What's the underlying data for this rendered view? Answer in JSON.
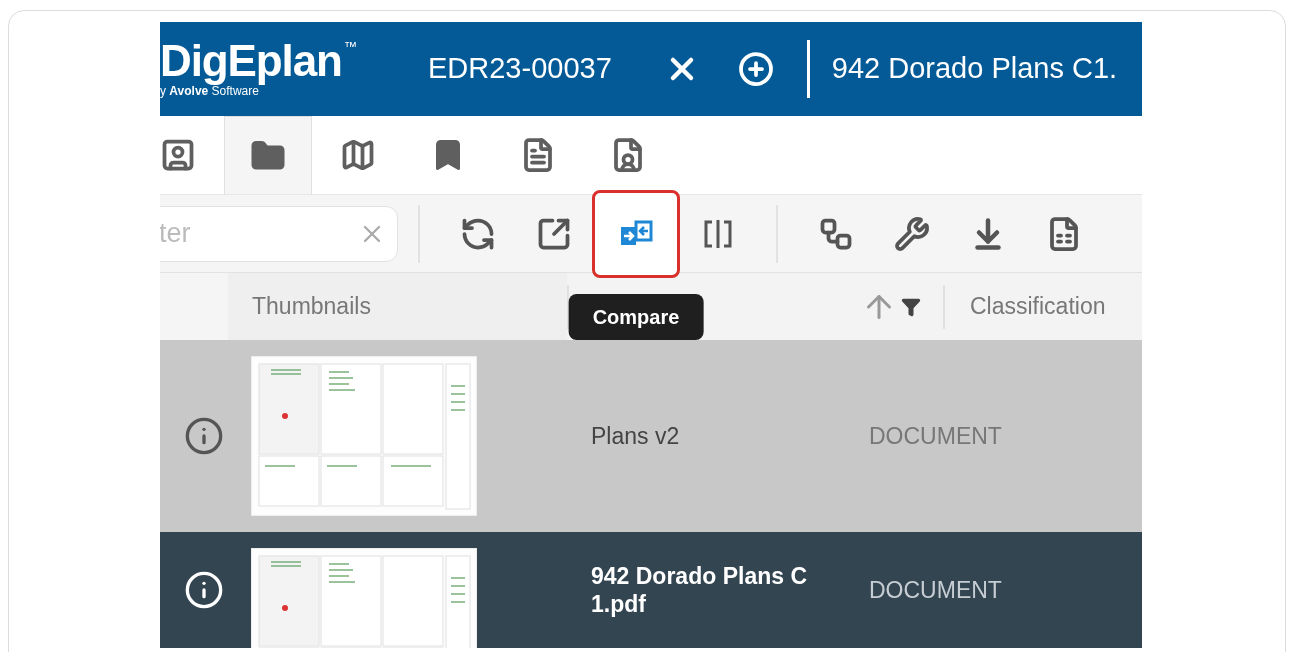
{
  "header": {
    "logo": "DigEplan",
    "logo_mark": "™",
    "logo_subtitle": "y **Avolve** Software",
    "tabs": [
      {
        "label": "EDR23-00037",
        "selected": true
      }
    ],
    "next_tab": "942 Dorado Plans C1."
  },
  "nav_tabs": [
    {
      "kind": "person",
      "selected": false
    },
    {
      "kind": "folder",
      "selected": true
    },
    {
      "kind": "map",
      "selected": false
    },
    {
      "kind": "bookmark",
      "selected": false
    },
    {
      "kind": "document",
      "selected": false
    },
    {
      "kind": "person-document",
      "selected": false
    }
  ],
  "toolbar": {
    "filter": {
      "placeholder": "ter"
    },
    "groups": [
      [
        {
          "kind": "sync",
          "highlighted": false
        },
        {
          "kind": "open",
          "highlighted": false
        },
        {
          "kind": "compare",
          "highlighted": true
        },
        {
          "kind": "split",
          "highlighted": false
        }
      ],
      [
        {
          "kind": "flow",
          "highlighted": false
        },
        {
          "kind": "tools",
          "highlighted": false
        },
        {
          "kind": "download",
          "highlighted": false
        },
        {
          "kind": "excel",
          "highlighted": false
        }
      ]
    ],
    "tooltip": "Compare"
  },
  "columns": {
    "thumbnails": "Thumbnails",
    "name_sorted_ascending": true,
    "classification": "Classification"
  },
  "rows": [
    {
      "name": "Plans v2",
      "classification": "DOCUMENT",
      "selected": false
    },
    {
      "name": "942 Dorado Plans C1.pdf",
      "classification": "DOCUMENT",
      "selected": true
    }
  ]
}
